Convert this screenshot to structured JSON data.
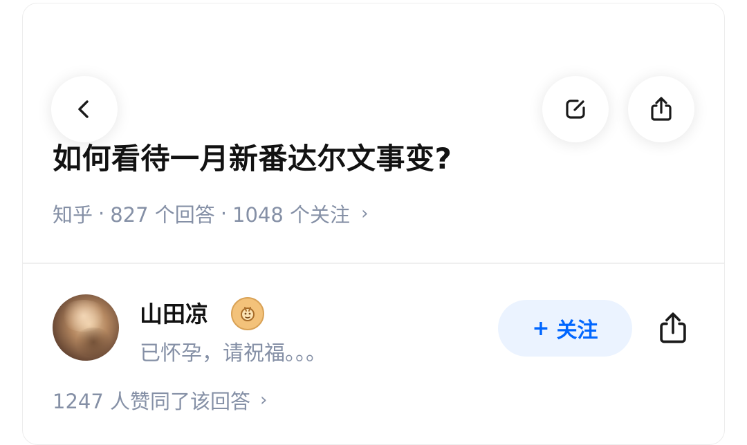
{
  "header": {
    "back_icon": "chevron-left-icon",
    "edit_icon": "edit-icon",
    "share_icon": "share-icon"
  },
  "question": {
    "title": "如何看待一月新番达尔文事变?",
    "source": "知乎",
    "separator": "·",
    "answers": "827 个回答",
    "followers": "1048 个关注",
    "chevron": "›"
  },
  "answer": {
    "author_name": "山田凉",
    "badge_icon": "creator-badge-icon",
    "author_bio": "已怀孕，请祝福。。。",
    "follow_plus": "+",
    "follow_label": "关注",
    "share_icon": "share-icon",
    "votes": "1247 人赞同了该回答",
    "chevron": "›"
  },
  "colors": {
    "primary_text": "#121212",
    "secondary_text": "#8590a6",
    "accent": "#0066ff",
    "follow_bg": "#ebf3ff"
  }
}
